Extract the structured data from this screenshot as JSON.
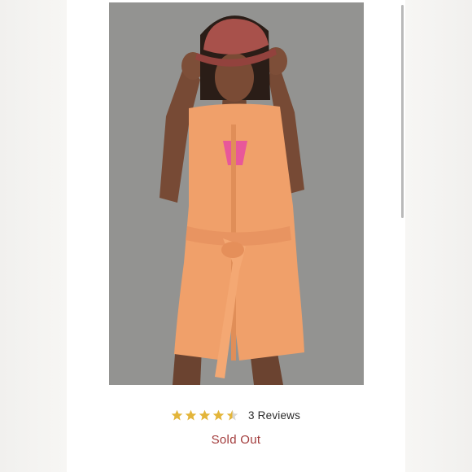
{
  "product": {
    "image_alt_icon": "product-photo",
    "rating_value": 4.5,
    "rating_max": 5,
    "reviews_label": "3 Reviews",
    "status": "Sold Out"
  },
  "colors": {
    "star": "#e3b53a",
    "status": "#a23b3b"
  }
}
